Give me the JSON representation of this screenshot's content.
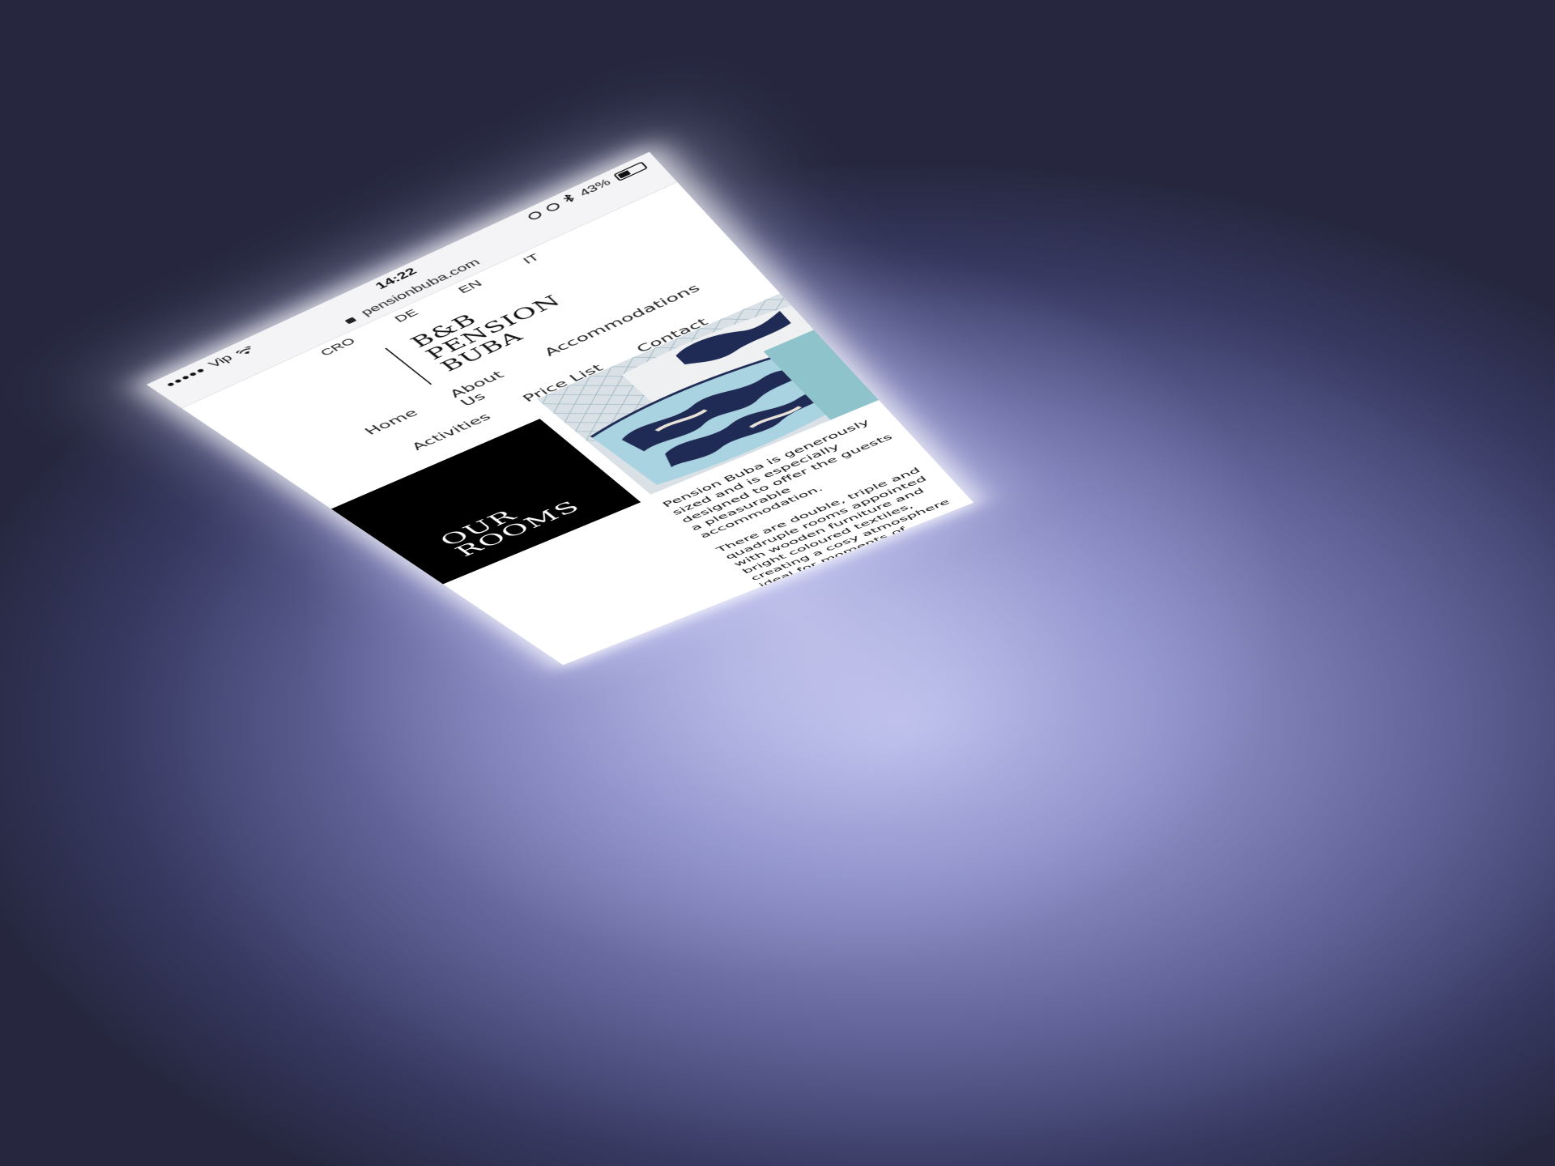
{
  "status_bar": {
    "carrier": "Vip",
    "signal": "●●●●●",
    "time": "14:22",
    "battery": "43%",
    "battery_level": 0.43
  },
  "browser": {
    "url": "pensionbuba.com"
  },
  "languages": [
    "CRO",
    "DE",
    "EN",
    "IT"
  ],
  "logo": {
    "line1": "B&B",
    "line2": "PENSION",
    "line3": "BUBA"
  },
  "nav": {
    "row1": [
      "Home",
      "About Us",
      "Accommodations"
    ],
    "row2": [
      "Activities",
      "Price List",
      "Contact"
    ]
  },
  "rooms": {
    "title_line1": "OUR",
    "title_line2": "ROOMS",
    "paragraphs": [
      "Pension Buba is generously sized and is especially designed to offer the guests a pleasurable accommodation.",
      "There are double, triple and quadruple rooms appointed with wooden furniture and bright coloured textiles, creating a cosy atmosphere ideal for moments of relaxation. All rooms are spacious and equipped with comfortable beds, a refrigerator, a bathroom with shower, and a safe to keep your valuable belongings secure. Daily cleaning service is included in the offer."
    ]
  },
  "colors": {
    "background_dark": "#26273f",
    "background_glow": "#b9bbe6",
    "title_box": "#000000",
    "pillow_navy": "#1f2a55",
    "pillow_light_blue": "#a9d3e0"
  }
}
